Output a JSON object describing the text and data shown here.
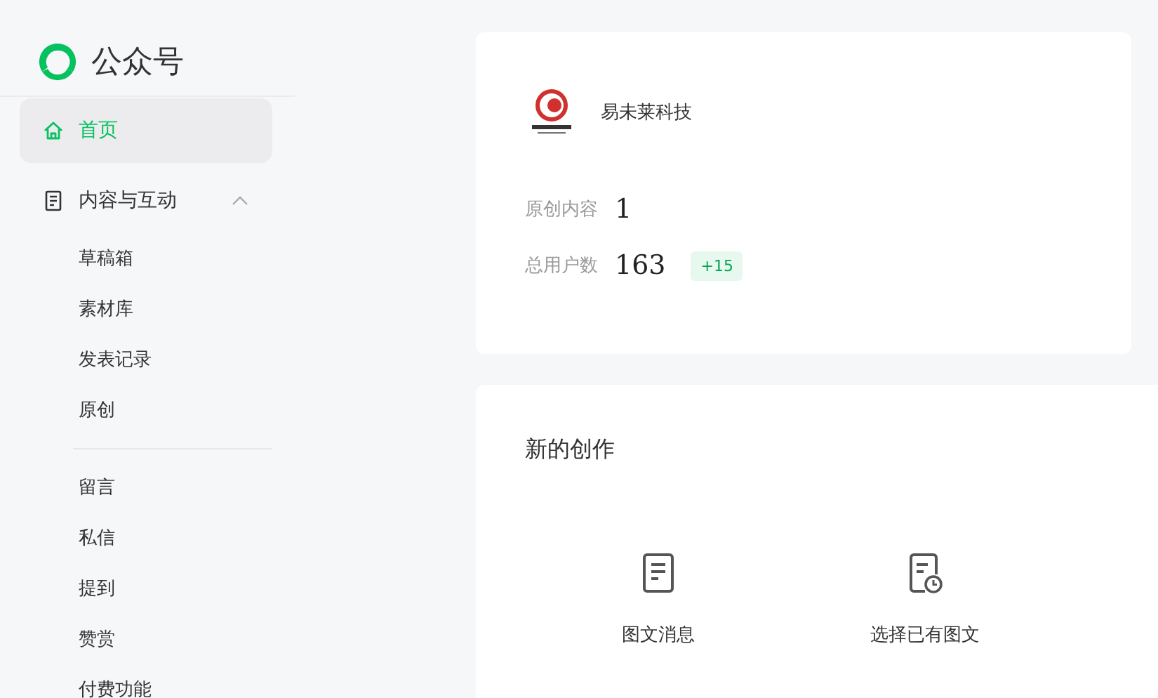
{
  "brand": {
    "title": "公众号"
  },
  "sidebar": {
    "items": [
      {
        "kind": "nav",
        "label": "首页",
        "selected": true
      },
      {
        "kind": "group",
        "label": "内容与互动",
        "expanded": true,
        "children": [
          {
            "label": "草稿箱",
            "selected": false
          },
          {
            "label": "素材库",
            "selected": false
          },
          {
            "label": "发表记录",
            "selected": false
          },
          {
            "label": "原创",
            "selected": false
          },
          {
            "label": "留言",
            "selected": false,
            "divider_before": true
          },
          {
            "label": "私信",
            "selected": false
          },
          {
            "label": "提到",
            "selected": false
          },
          {
            "label": "赞赏",
            "selected": false
          },
          {
            "label": "付费功能",
            "selected": false
          }
        ]
      }
    ]
  },
  "account": {
    "name": "易未莱科技",
    "stats": [
      {
        "label": "原创内容",
        "value": "1"
      },
      {
        "label": "总用户数",
        "value": "163",
        "badge": "+15"
      }
    ]
  },
  "create": {
    "title": "新的创作",
    "actions": [
      {
        "kind": "doc",
        "label": "图文消息"
      },
      {
        "kind": "doc-clock",
        "label": "选择已有图文"
      }
    ]
  }
}
